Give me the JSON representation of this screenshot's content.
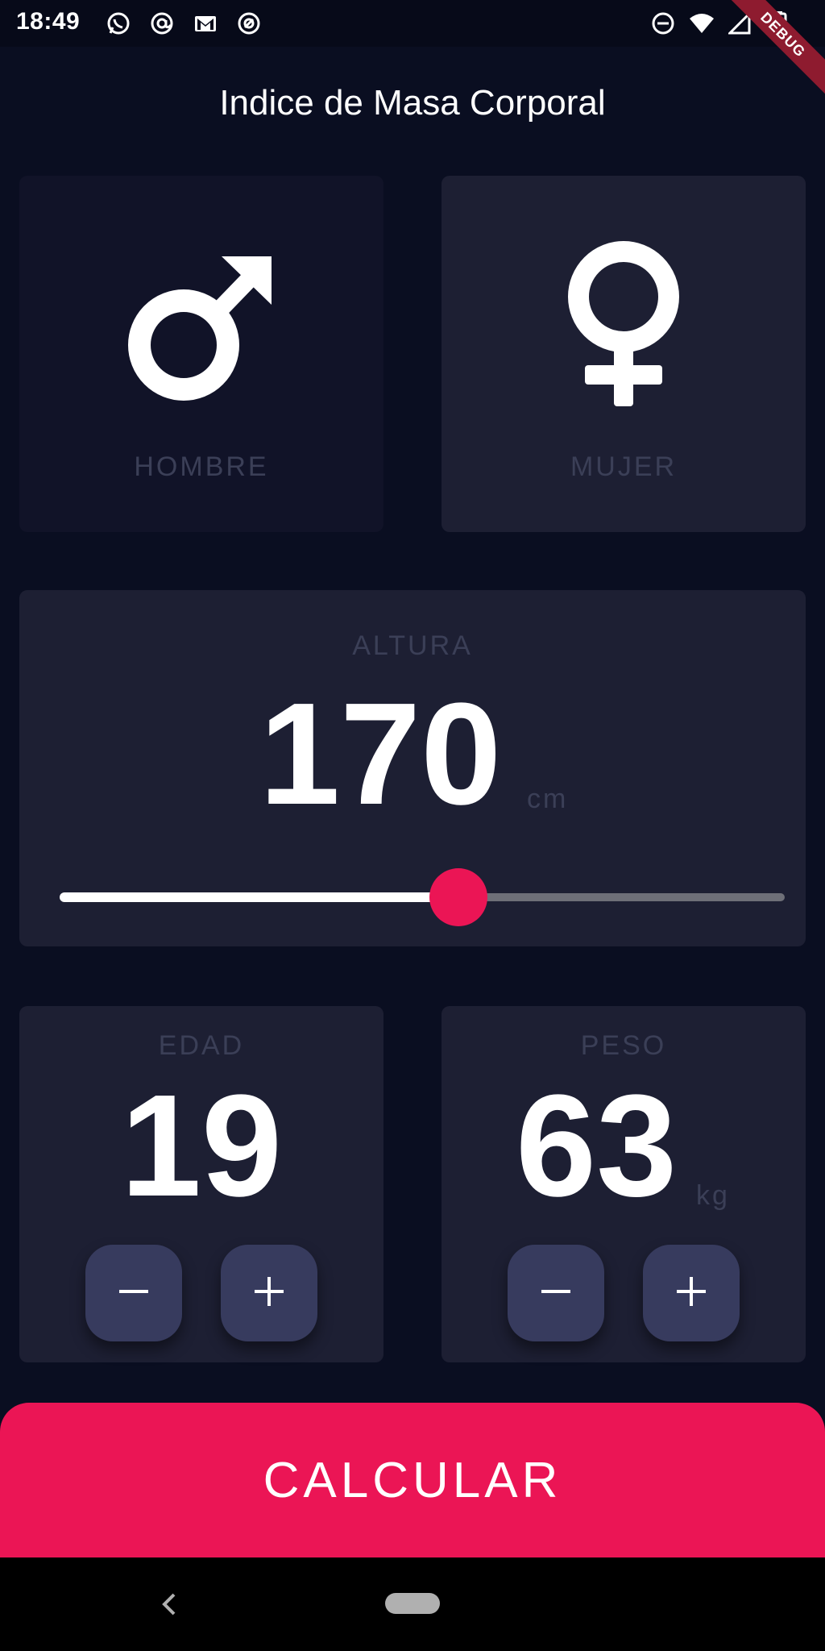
{
  "status_bar": {
    "time": "18:49",
    "left_icons": [
      "whatsapp-icon",
      "at-sign-icon",
      "gmail-icon",
      "at-sign-icon"
    ],
    "right_icons": [
      "do-not-disturb-icon",
      "wifi-icon",
      "cell-signal-icon",
      "battery-icon"
    ],
    "debug_banner": "DEBUG"
  },
  "app_bar": {
    "title": "Indice de Masa Corporal"
  },
  "gender": {
    "male": {
      "label": "HOMBRE",
      "icon": "mars-icon",
      "selected": true
    },
    "female": {
      "label": "MUJER",
      "icon": "venus-icon",
      "selected": false
    }
  },
  "height": {
    "label": "ALTURA",
    "value": "170",
    "unit": "cm",
    "slider_fraction": 0.55
  },
  "age": {
    "label": "EDAD",
    "value": "19",
    "minus_icon": "minus-icon",
    "plus_icon": "plus-icon"
  },
  "weight": {
    "label": "PESO",
    "value": "63",
    "unit": "kg",
    "minus_icon": "minus-icon",
    "plus_icon": "plus-icon"
  },
  "calculate_button": {
    "label": "CALCULAR"
  },
  "colors": {
    "background": "#0a0e21",
    "card": "#1d1f33",
    "card_selected": "#111328",
    "accent": "#eb1555",
    "button": "#373b5e",
    "label": "#3b3f57"
  },
  "nav_bar": {
    "icons": [
      "back-icon",
      "home-pill-icon"
    ]
  }
}
